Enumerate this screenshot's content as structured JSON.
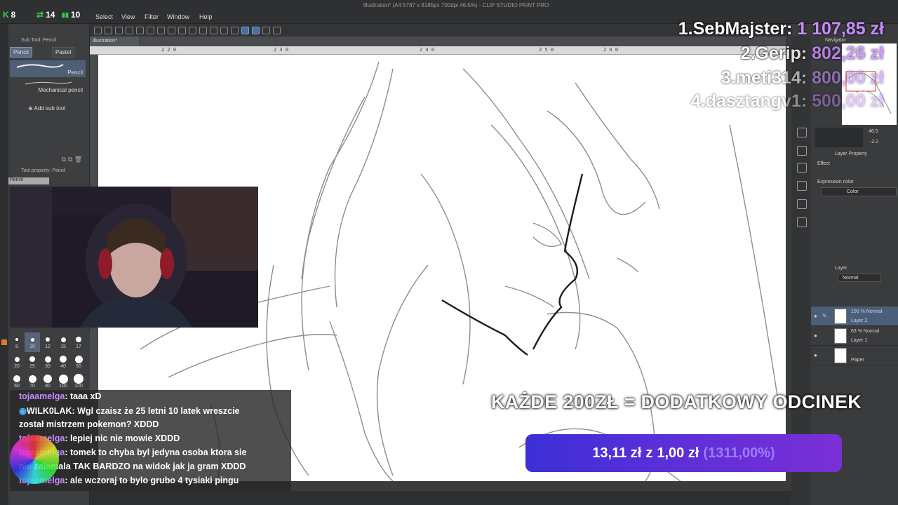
{
  "stream": {
    "stat_a": {
      "icon": "K",
      "value": "8",
      "color": "#37d04a"
    },
    "stat_b": {
      "icon": "⇄",
      "value": "14",
      "color": "#37d04a"
    },
    "stat_c": {
      "icon": "▮▮",
      "value": "10",
      "color": "#37d04a"
    }
  },
  "app": {
    "window_title": "Illustration* (A4 5787 x 8185px 700dpi 46.5%) - CLIP STUDIO PAINT PRO",
    "menu": [
      "Select",
      "View",
      "Filter",
      "Window",
      "Help"
    ],
    "doc_tab": "Illustration*",
    "ruler_labels": [
      "2 2 0",
      "2 3 0",
      "2 4 0",
      "2 5 0",
      "2 6 0"
    ]
  },
  "sub_tool": {
    "title": "Sub Tool: Pencil",
    "tabs": [
      "Pencil",
      "Pastel"
    ],
    "brushes": [
      "Pencil",
      "Mechanical pencil"
    ],
    "add_label": "Add sub tool",
    "tool_property_title": "Tool property: Pencil",
    "tool_property_value": "Pencil"
  },
  "brush_sizes": [
    "8",
    "10",
    "12",
    "15",
    "17",
    "20",
    "25",
    "30",
    "40",
    "50",
    "60",
    "70",
    "80",
    "100",
    "120"
  ],
  "right_panel": {
    "navigator_title": "Navigator",
    "zoom_value": "46.5",
    "rotate_value": "-2.2",
    "layer_property_title": "Layer Property",
    "effect_label": "Effect",
    "expression_color_label": "Expression color",
    "color_value": "Color",
    "layer_title": "Layer",
    "blend_mode": "Normal",
    "layers": [
      {
        "opacity": "100 % Normal",
        "name": "Layer 2"
      },
      {
        "opacity": "63 % Normal",
        "name": "Layer 1"
      },
      {
        "opacity": "",
        "name": "Paper"
      }
    ]
  },
  "leaderboard": [
    {
      "name": "1.SebMajster:",
      "amount": "1 107,85 zł"
    },
    {
      "name": "2.Gerip:",
      "amount": "802,26 zł"
    },
    {
      "name": "3.meti314:",
      "amount": "800,00 zł"
    },
    {
      "name": "4.dasztangv1:",
      "amount": "500,00 zł"
    }
  ],
  "banner": "KAŻDE 200ZŁ = DODATKOWY ODCINEK",
  "donation_goal": {
    "current": "13,11 zł",
    "sep": "z",
    "goal": "1,00 zł",
    "percent": "(1311,00%)"
  },
  "chat": [
    {
      "user": "tojaamelga",
      "text": ": taaa xD"
    },
    {
      "user": "WILK0LAK",
      "text": ": Wgl czaisz że 25 letni 10 latek wreszcie"
    },
    {
      "user": "",
      "text": "został mistrzem pokemon? XDDD"
    },
    {
      "user": "tojaamelga",
      "text": ": lepiej nic nie mowie XDDD"
    },
    {
      "user": "tojaamelga",
      "text": ": tomek to chyba byl jedyna osoba ktora sie"
    },
    {
      "user": "",
      "text": "nie zalamala TAK BARDZO na widok jak ja gram XDDD"
    },
    {
      "user": "tojaamelga",
      "text": ": ale wczoraj to bylo grubo 4 tysiaki pingu"
    }
  ],
  "colors": {
    "accent_purple": "#c68bff",
    "donation_bar": "#4a2fd6",
    "panel_bg": "#3d3e40"
  }
}
